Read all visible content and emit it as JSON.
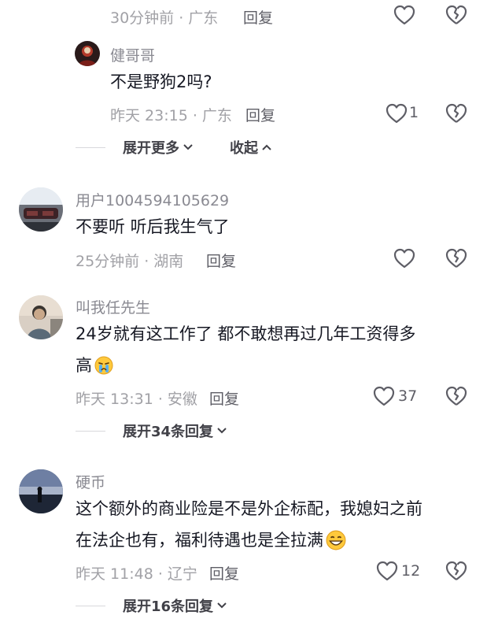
{
  "top_meta": {
    "time_location": "30分钟前 · 广东",
    "reply_label": "回复"
  },
  "sub_comment": {
    "username": "健哥哥",
    "text": "不是野狗2吗?",
    "time_location": "昨天 23:15 · 广东",
    "reply_label": "回复",
    "like_count": "1"
  },
  "thread_controls": {
    "expand_more": "展开更多",
    "collapse": "收起"
  },
  "comments": [
    {
      "username": "用户1004594105629",
      "text": "不要听 听后我生气了",
      "time_location": "25分钟前 · 湖南",
      "reply_label": "回复",
      "like_count": ""
    },
    {
      "username": "叫我任先生",
      "text_line1": "24岁就有这工作了 都不敢想再过几年工资得多",
      "text_line2": "高",
      "emoji": "crying-face-emoji",
      "time_location": "昨天 13:31 · 安徽",
      "reply_label": "回复",
      "like_count": "37",
      "expand_replies": "展开34条回复"
    },
    {
      "username": "硬币",
      "text_line1": "这个额外的商业险是不是外企标配，我媳妇之前",
      "text_line2": "在法企也有，福利待遇也是全拉满",
      "emoji": "grinning-face-emoji",
      "time_location": "昨天 11:48 · 辽宁",
      "reply_label": "回复",
      "like_count": "12",
      "expand_replies": "展开16条回复"
    }
  ],
  "icons": [
    "heart-outline-icon",
    "broken-heart-outline-icon",
    "chevron-down-icon",
    "chevron-up-icon"
  ],
  "colors": {
    "text": "#161823",
    "meta": "#a1a1a6",
    "icon": "#5e5e66"
  }
}
